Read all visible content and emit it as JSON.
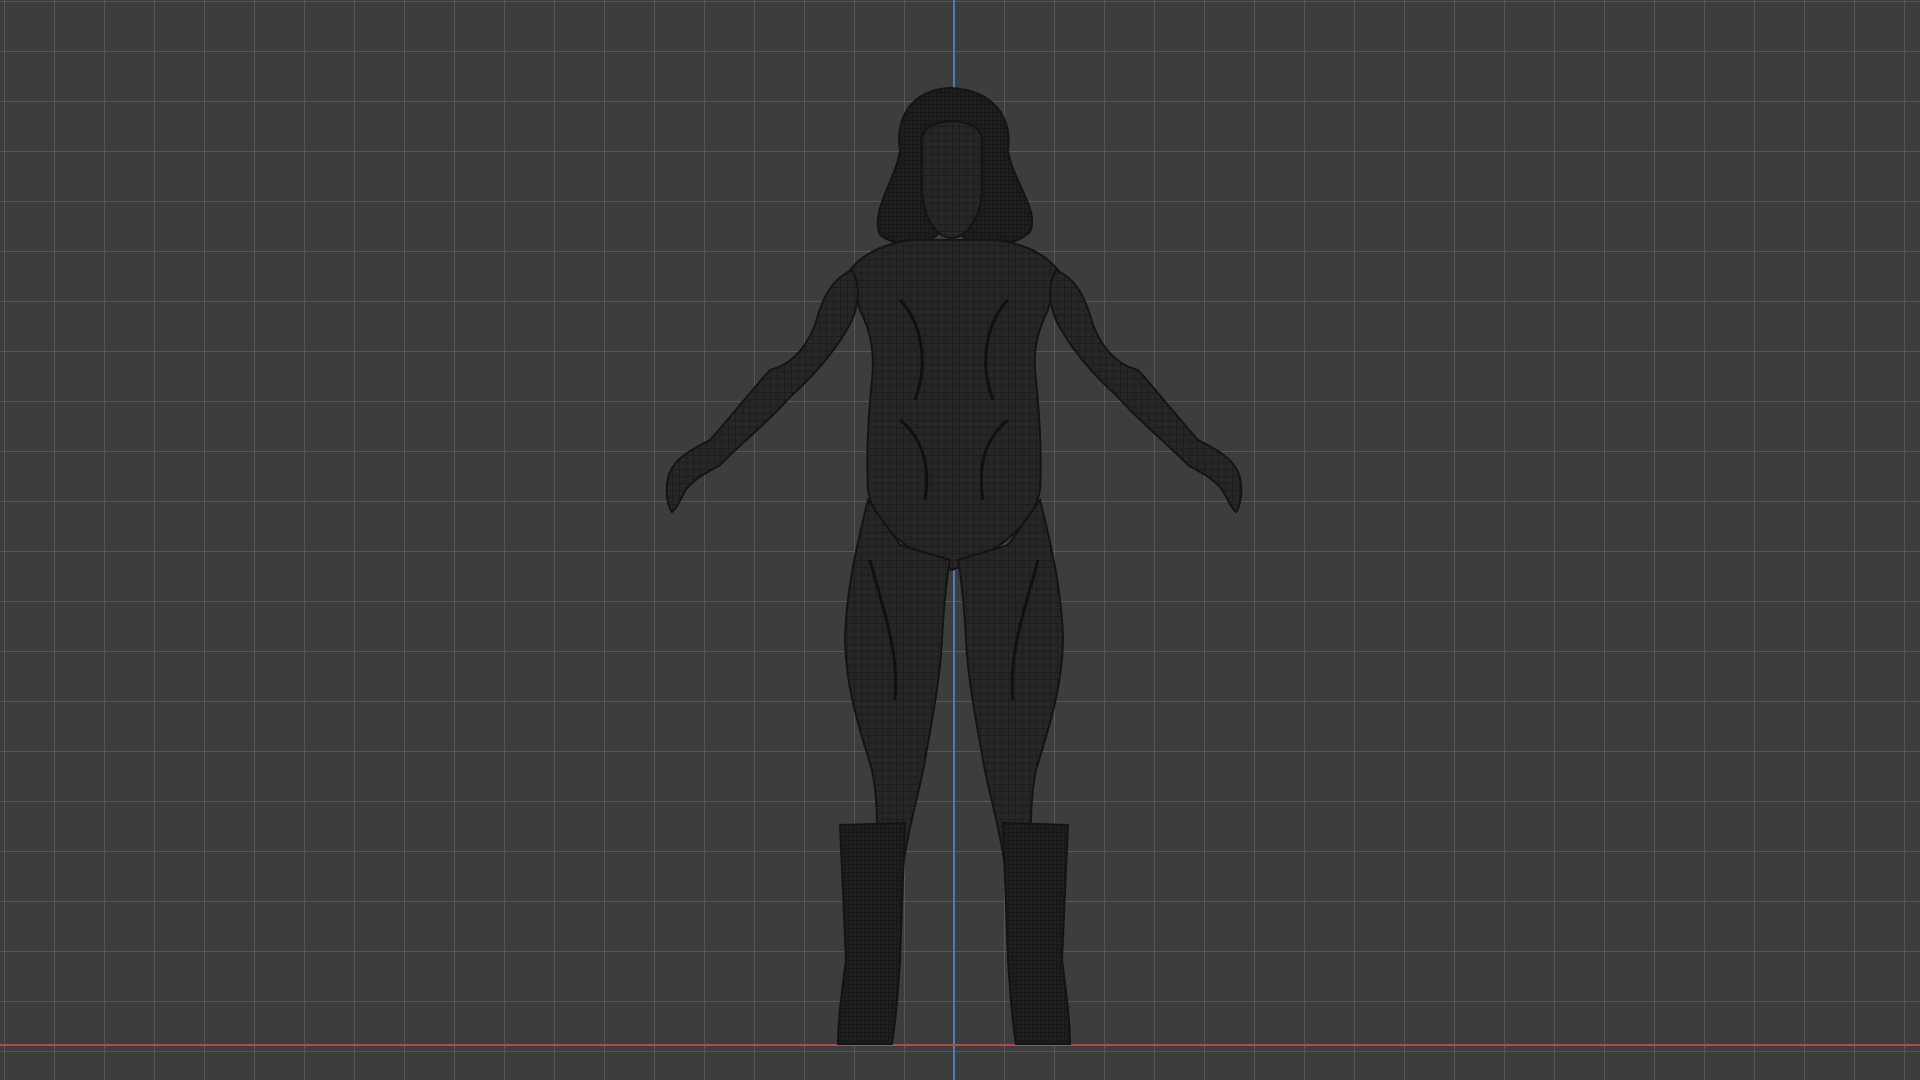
{
  "viewport": {
    "background_color": "#3d3d3d",
    "grid_color": "#5f5f5f",
    "view": "front-orthographic",
    "shading": "wireframe"
  },
  "axes": {
    "y_axis_color": "#4c7fb8",
    "x_axis_color": "#b34a4a"
  },
  "model": {
    "icon": "female-character-wireframe",
    "pose": "A-pose",
    "wire_color": "#1c1c1c",
    "fill_color": "#262626"
  }
}
